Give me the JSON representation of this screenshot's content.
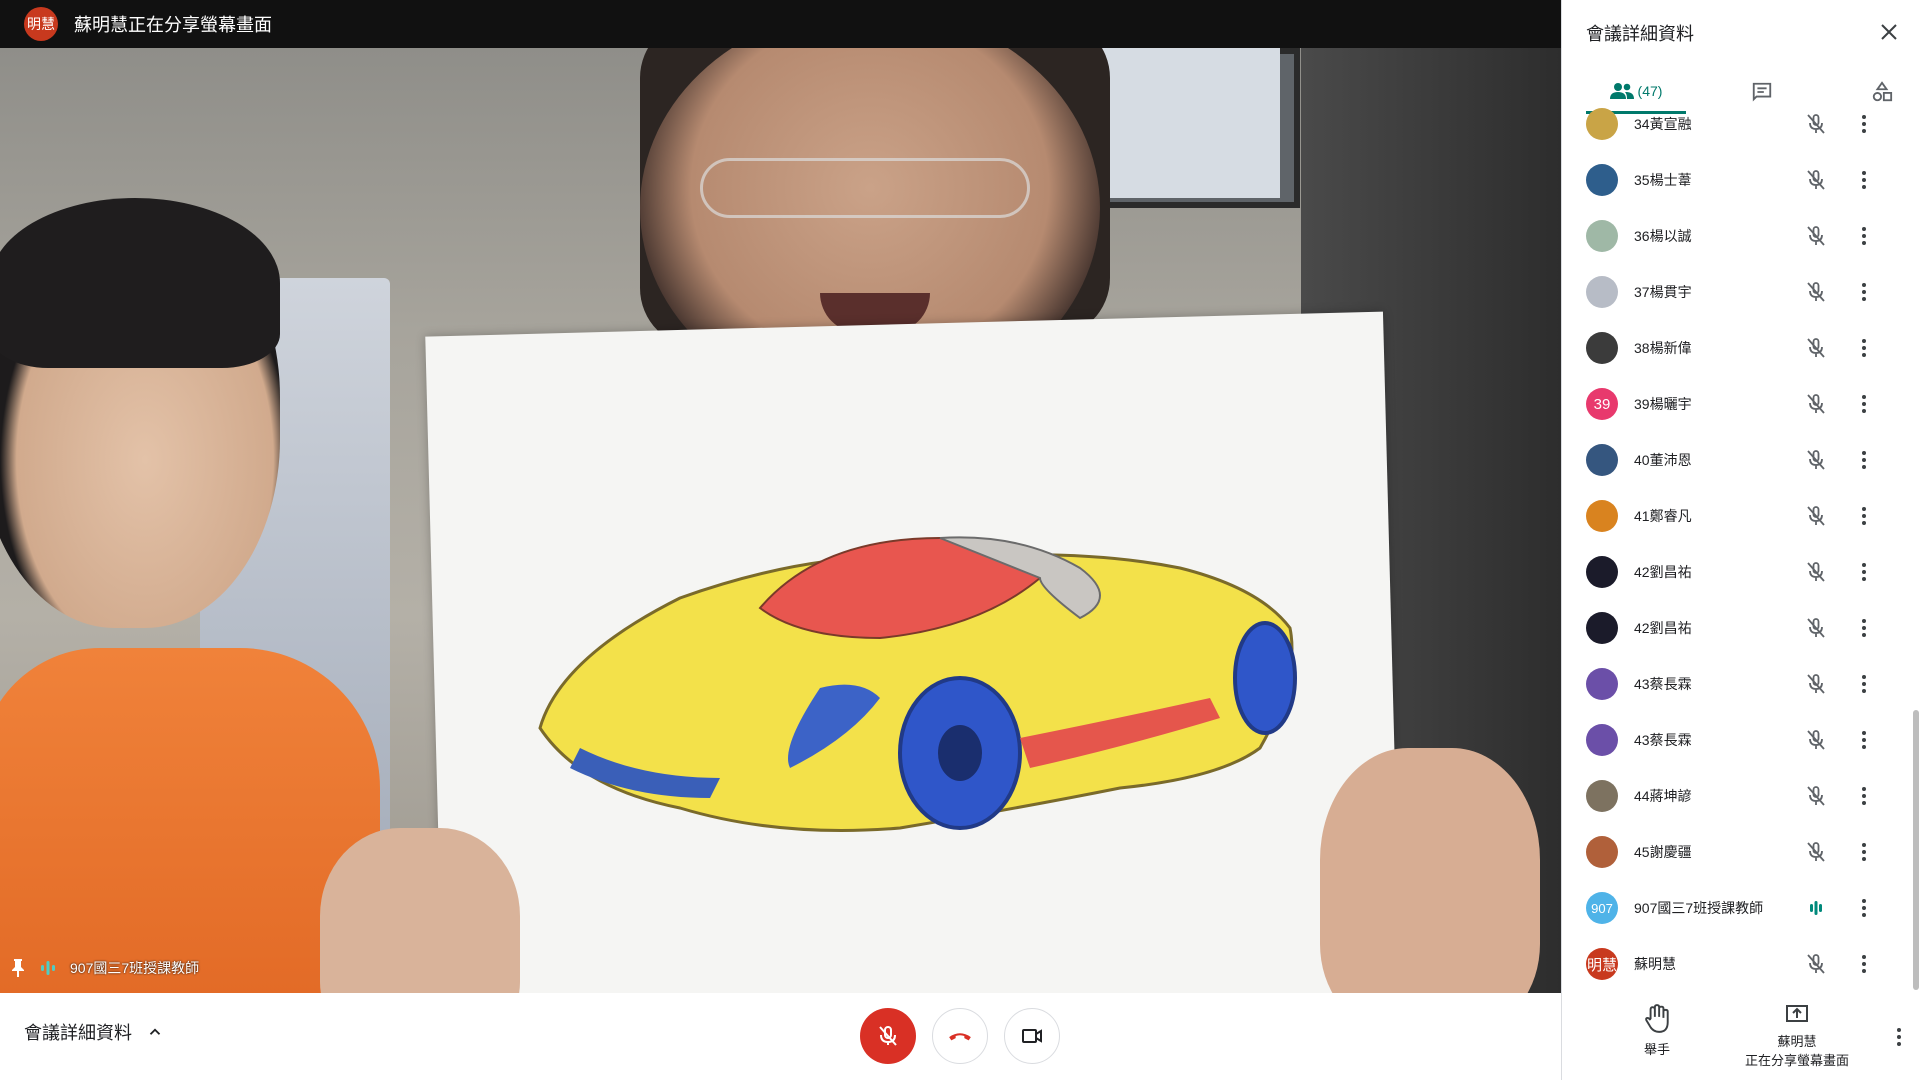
{
  "topbar": {
    "presenter_avatar": "明慧",
    "presenter_text": "蘇明慧正在分享螢幕畫面"
  },
  "video": {
    "caption": "907國三7班授課教師",
    "pin_icon": "pin-icon",
    "talking_icon": "audio-level-icon"
  },
  "bottombar": {
    "details_label": "會議詳細資料",
    "mic_icon": "mic-off-icon",
    "hangup_icon": "call-end-icon",
    "camera_icon": "videocam-icon",
    "accent_red": "#d93025"
  },
  "panel": {
    "title": "會議詳細資料",
    "people_count": "(47)",
    "accent": "#00796b",
    "participants": [
      {
        "name": "34黃宣融",
        "avatar_color": "#c9a446",
        "avatar_text": ""
      },
      {
        "name": "35楊士葦",
        "avatar_color": "#2e5e8c",
        "avatar_text": ""
      },
      {
        "name": "36楊以誠",
        "avatar_color": "#9fb8a6",
        "avatar_text": ""
      },
      {
        "name": "37楊貫宇",
        "avatar_color": "#b7bcc6",
        "avatar_text": ""
      },
      {
        "name": "38楊新偉",
        "avatar_color": "#3b3b3b",
        "avatar_text": ""
      },
      {
        "name": "39楊曬宇",
        "avatar_color": "#e8396d",
        "avatar_text": "39"
      },
      {
        "name": "40董沛恩",
        "avatar_color": "#35567f",
        "avatar_text": ""
      },
      {
        "name": "41鄭睿凡",
        "avatar_color": "#d9831f",
        "avatar_text": ""
      },
      {
        "name": "42劉昌祐",
        "avatar_color": "#1b1b2a",
        "avatar_text": ""
      },
      {
        "name": "42劉昌祐",
        "avatar_color": "#1b1b2a",
        "avatar_text": ""
      },
      {
        "name": "43蔡長霖",
        "avatar_color": "#6b4fa8",
        "avatar_text": ""
      },
      {
        "name": "43蔡長霖",
        "avatar_color": "#6b4fa8",
        "avatar_text": ""
      },
      {
        "name": "44蔣坤諺",
        "avatar_color": "#7d7260",
        "avatar_text": ""
      },
      {
        "name": "45謝慶疆",
        "avatar_color": "#b0603a",
        "avatar_text": ""
      },
      {
        "name": "907國三7班授課教師",
        "avatar_color": "#4fb3e8",
        "avatar_text": "907",
        "speaking": true
      },
      {
        "name": "蘇明慧",
        "avatar_color": "#c8391e",
        "avatar_text": "明慧"
      }
    ],
    "raise_hand_label": "舉手",
    "present_label_1": "蘇明慧",
    "present_label_2": "正在分享螢幕畫面"
  }
}
